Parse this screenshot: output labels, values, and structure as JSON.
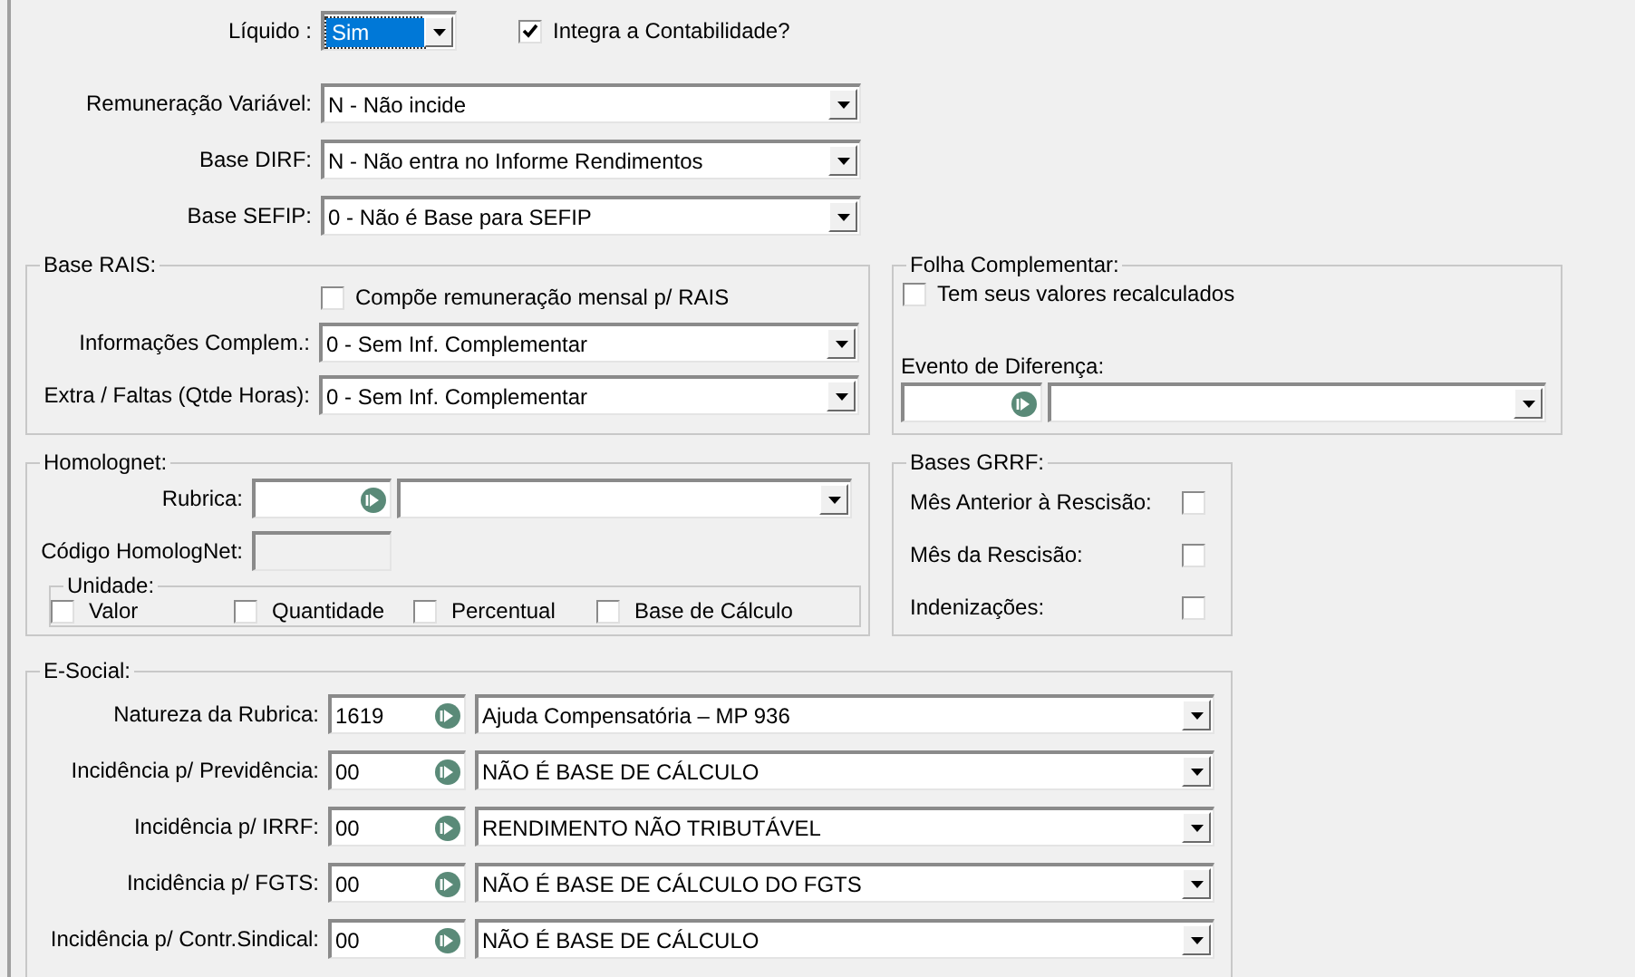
{
  "liquido": {
    "label": "Líquido :",
    "value": "Sim"
  },
  "integra": {
    "label": "Integra a Contabilidade?",
    "checked": true
  },
  "top_fields": [
    {
      "label": "Remuneração Variável:",
      "value": "N - Não incide"
    },
    {
      "label": "Base DIRF:",
      "value": "N - Não entra no Informe Rendimentos"
    },
    {
      "label": "Base SEFIP:",
      "value": "0 - Não é Base para SEFIP"
    }
  ],
  "base_rais": {
    "title": "Base RAIS:",
    "compoe": {
      "label": "Compõe remuneração mensal p/ RAIS",
      "checked": false
    },
    "fields": [
      {
        "label": "Informações Complem.:",
        "value": "0 - Sem Inf. Complementar"
      },
      {
        "label": "Extra / Faltas (Qtde Horas):",
        "value": "0 - Sem Inf. Complementar"
      }
    ]
  },
  "folha_complementar": {
    "title": "Folha Complementar:",
    "recalc": {
      "label": "Tem seus valores recalculados",
      "checked": false
    },
    "evento_label": "Evento de Diferença:"
  },
  "homolognet": {
    "title": "Homolognet:",
    "rubrica_label": "Rubrica:",
    "codigo": {
      "label": "Código HomologNet:",
      "disabled": true
    },
    "unidade": {
      "title": "Unidade:",
      "options": [
        {
          "label": "Valor",
          "checked": false
        },
        {
          "label": "Quantidade",
          "checked": false
        },
        {
          "label": "Percentual",
          "checked": false
        },
        {
          "label": "Base de Cálculo",
          "checked": false
        }
      ]
    }
  },
  "bases_grrf": {
    "title": "Bases GRRF:",
    "items": [
      {
        "label": "Mês Anterior à Rescisão:",
        "checked": false
      },
      {
        "label": "Mês da Rescisão:",
        "checked": false
      },
      {
        "label": "Indenizações:",
        "checked": false
      }
    ]
  },
  "esocial": {
    "title": "E-Social:",
    "rows": [
      {
        "label": "Natureza da Rubrica:",
        "code": "1619",
        "value": "Ajuda Compensatória – MP 936"
      },
      {
        "label": "Incidência p/ Previdência:",
        "code": "00",
        "value": "NÃO É BASE DE CÁLCULO"
      },
      {
        "label": "Incidência p/ IRRF:",
        "code": "00",
        "value": "RENDIMENTO NÃO TRIBUTÁVEL"
      },
      {
        "label": "Incidência p/ FGTS:",
        "code": "00",
        "value": "NÃO É BASE DE CÁLCULO DO FGTS"
      },
      {
        "label": "Incidência p/ Contr.Sindical:",
        "code": "00",
        "value": "NÃO É BASE DE CÁLCULO"
      }
    ]
  }
}
